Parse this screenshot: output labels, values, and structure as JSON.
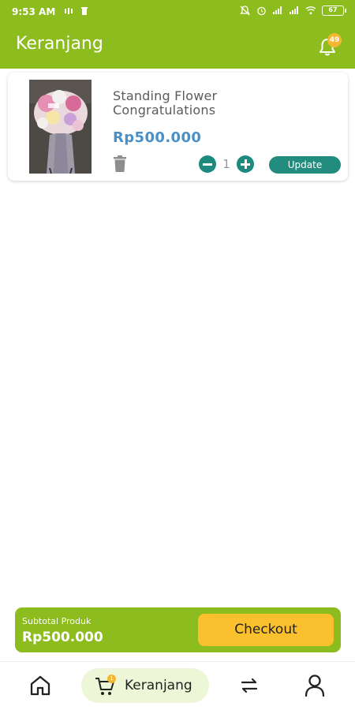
{
  "status_bar": {
    "time": "9:53 AM",
    "battery": "67"
  },
  "header": {
    "title": "Keranjang",
    "notification_count": "49"
  },
  "cart": {
    "items": [
      {
        "name": "Standing Flower Congratulations",
        "price": "Rp500.000",
        "quantity": "1",
        "update_label": "Update"
      }
    ]
  },
  "checkout": {
    "subtotal_label": "Subtotal Produk",
    "subtotal_value": "Rp500.000",
    "button_label": "Checkout"
  },
  "bottom_nav": {
    "cart_badge": "1",
    "cart_label": "Keranjang"
  },
  "colors": {
    "primary_green": "#8cbc1e",
    "teal": "#228c7e",
    "price_blue": "#4a90c8",
    "checkout_yellow": "#fbc02d",
    "badge_orange": "#f5b731"
  },
  "icons": [
    "bell-icon",
    "trash-icon",
    "minus-icon",
    "plus-icon",
    "home-icon",
    "cart-icon",
    "transfer-icon",
    "profile-icon"
  ]
}
